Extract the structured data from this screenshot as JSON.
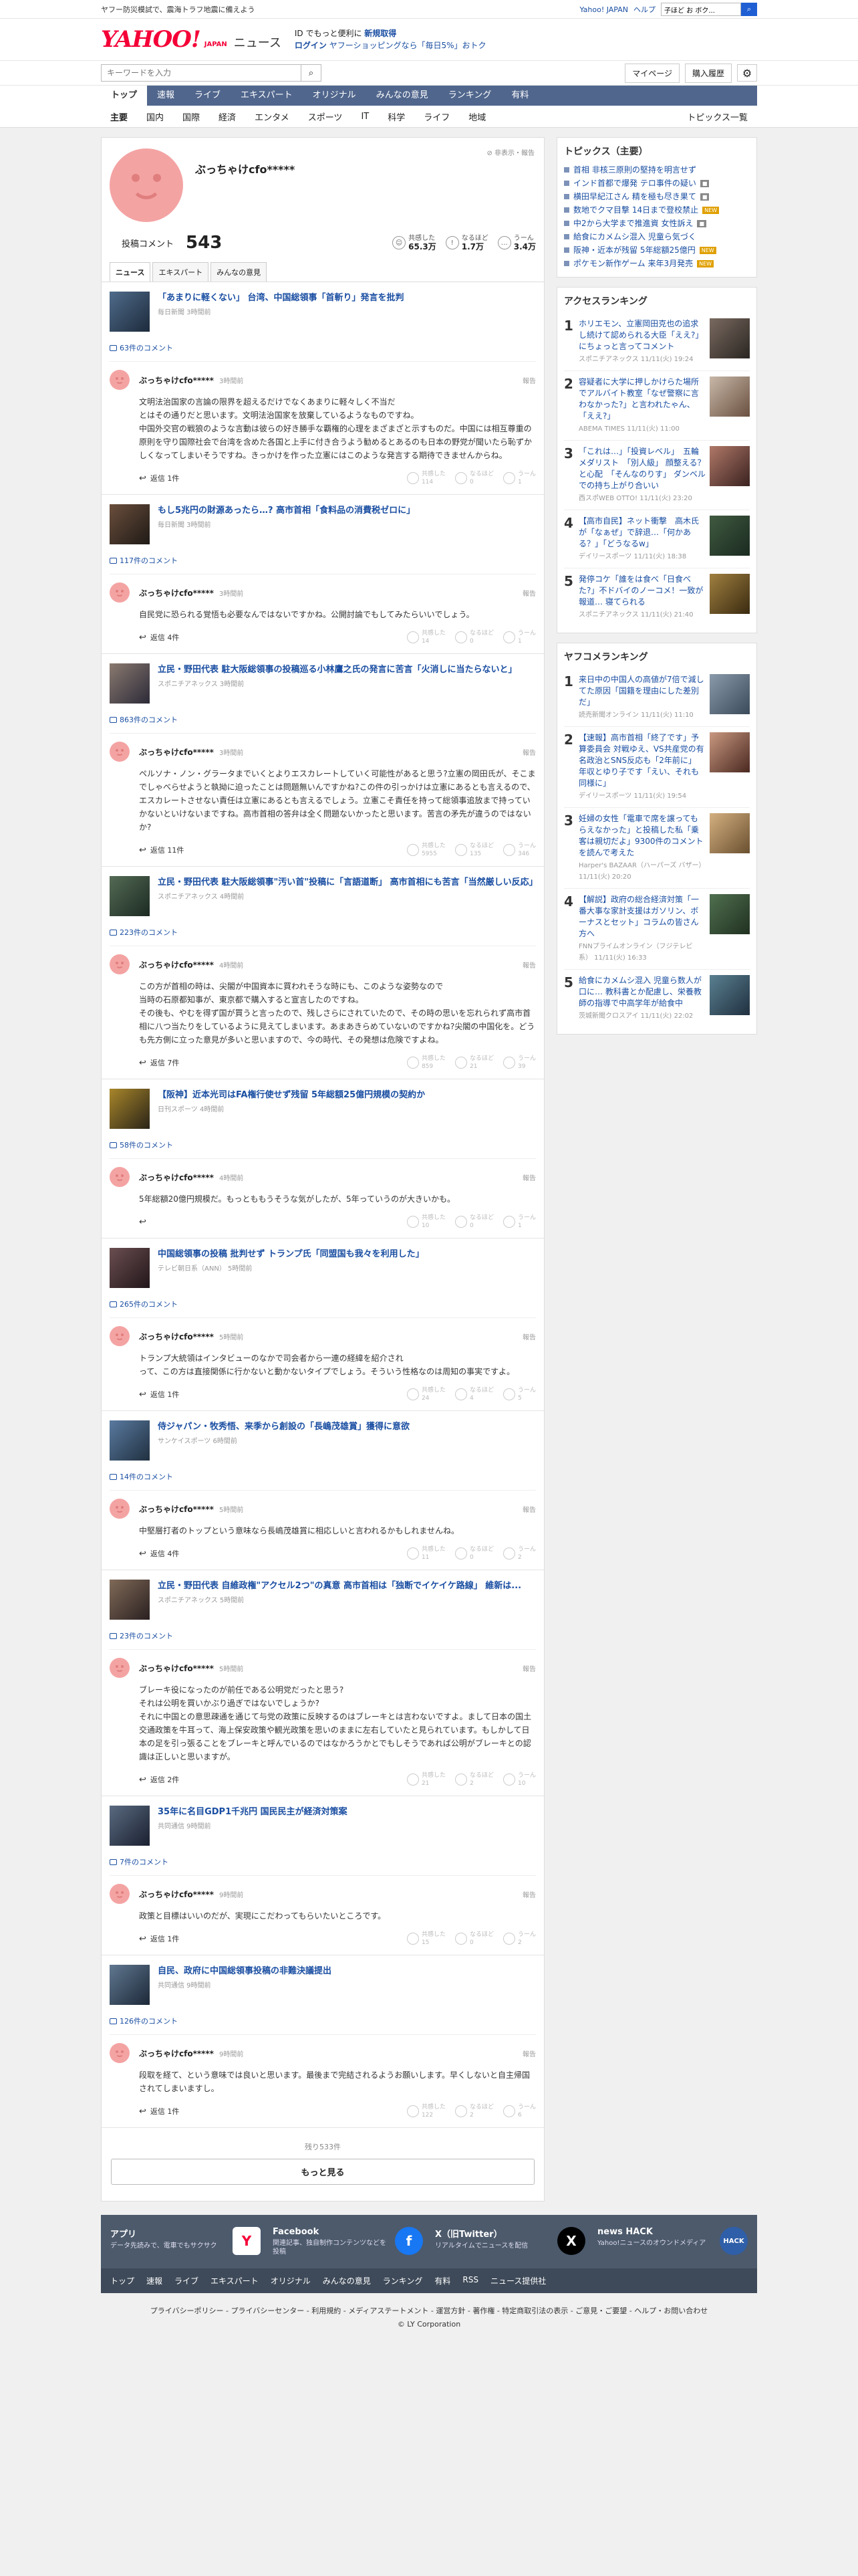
{
  "topbar": {
    "left": "ヤフー防災模試で、震海トラフ地震に備えよう",
    "links": [
      "Yahoo! JAPAN",
      "ヘルプ"
    ],
    "search_placeholder": "ウェブ検索",
    "search_value": "子ほど お ボク..."
  },
  "masthead": {
    "logo": "YAHOO!",
    "logo_sub": "JAPAN",
    "service": "ニュース",
    "promo_line1_prefix": "ID でもっと便利に",
    "promo_line1_link": "新規取得",
    "promo_line2_login": "ログイン",
    "promo_line2_rest": "ヤフーショッピングなら「毎日5%」おトク"
  },
  "search": {
    "placeholder": "キーワードを入力",
    "buttons": [
      "マイページ",
      "購入履歴"
    ]
  },
  "nav_primary": [
    "トップ",
    "速報",
    "ライブ",
    "エキスパート",
    "オリジナル",
    "みんなの意見",
    "ランキング",
    "有料"
  ],
  "nav_secondary": [
    "主要",
    "国内",
    "国際",
    "経済",
    "エンタメ",
    "スポーツ",
    "IT",
    "科学",
    "ライフ",
    "地域"
  ],
  "nav_secondary_right": "トピックス一覧",
  "profile": {
    "name": "ぶっちゃけcfo*****",
    "report": "非表示・報告",
    "count_label": "投稿コメント",
    "count": "543",
    "reactions": [
      {
        "label": "共感した",
        "value": "65.3万"
      },
      {
        "label": "なるほど",
        "value": "1.7万"
      },
      {
        "label": "うーん",
        "value": "3.4万"
      }
    ]
  },
  "tabs": [
    "ニュース",
    "エキスパート",
    "みんなの意見"
  ],
  "vote_labels": [
    "共感した",
    "なるほど",
    "うーん"
  ],
  "reply_label": "返信",
  "report_label": "報告",
  "entries": [
    {
      "title": "「あまりに軽くない」 台湾、中国総領事「首斬り」発言を批判",
      "source": "毎日新聞 3時間前",
      "count": "63件のコメント",
      "user": "ぶっちゃけcfo*****",
      "time": "3時間前",
      "body": "文明法治国家の言論の限界を超えるだけでなくあまりに軽々しく不当だ\nとはその通りだと思います。文明法治国家を放棄しているようなものですね。\n中国外交官の戦狼のような言動は彼らの好き勝手な覇権的心理をまざまざと示すものだ。中国には相互尊重の原則を守り国際社会で台湾を含めた各国と上手に付き合うよう勧めるとあるのも日本の野党が聞いたら恥ずかしくなってしまいそうですね。きっかけを作った立憲にはこのような発言する期待できませんからね。",
      "replies": "返信 1件",
      "v": [
        "114",
        "0",
        "1"
      ]
    },
    {
      "title": "もし5兆円の財源あったら…? 高市首相「食料品の消費税ゼロに」",
      "source": "毎日新聞 3時間前",
      "count": "117件のコメント",
      "user": "ぶっちゃけcfo*****",
      "time": "3時間前",
      "body": "自民党に恐られる覚悟も必要なんではないですかね。公開討論でもしてみたらいいでしょう。",
      "replies": "返信 4件",
      "v": [
        "14",
        "0",
        "1"
      ]
    },
    {
      "title": "立民・野田代表 駐大阪総領事の投稿巡る小林鷹之氏の発言に苦言「火消しに当たらないと」",
      "source": "スポニチアネックス 3時間前",
      "count": "863件のコメント",
      "user": "ぶっちゃけcfo*****",
      "time": "3時間前",
      "body": "ペルソナ・ノン・グラータまでいくとよりエスカレートしていく可能性があると思う?立憲の岡田氏が、そこまでしゃべらせようと執拗に迫ったことは問題無いんですかね?この件の引っかけは立憲にあるとも言えるので、エスカレートさせない責任は立憲にあるとも言えるでしょう。立憲こそ責任を持って総領事追放まで持っていかないといけないまですね。高市首相の答弁は全く問題ないかったと思います。苦言の矛先が違うのではないか?",
      "replies": "返信 11件",
      "v": [
        "5955",
        "135",
        "346"
      ]
    },
    {
      "title": "立民・野田代表 駐大阪総領事\"汚い首\"投稿に「言語道断」 高市首相にも苦言「当然厳しい反応」",
      "source": "スポニチアネックス 4時間前",
      "count": "223件のコメント",
      "user": "ぶっちゃけcfo*****",
      "time": "4時間前",
      "body": "この方が首相の時は、尖閣が中国資本に買われそうな時にも、このような姿勢なので\n当時の石原都知事が、東京都で購入すると宣言したのですね。\nその後も、やむを得ず国が買うと言ったので、残しさらにされていたので、その時の思いを忘れられず高市首相に八つ当たりをしているように見えてしまいます。あまあきらめていないのですかね?尖閣の中国化を。どうも先方側に立った意見が多いと思いますので、今の時代、その発想は危険ですよね。",
      "replies": "返信 7件",
      "v": [
        "859",
        "21",
        "39"
      ]
    },
    {
      "title": "【阪神】近本光司はFA権行使せず残留 5年総額25億円規模の契約か",
      "source": "日刊スポーツ 4時間前",
      "count": "58件のコメント",
      "user": "ぶっちゃけcfo*****",
      "time": "4時間前",
      "body": "5年総額20億円規模だ。もっとももうそうな気がしたが、5年っていうのが大きいかも。",
      "replies": "",
      "v": [
        "10",
        "0",
        "1"
      ]
    },
    {
      "title": "中国総領事の投稿 批判せず トランプ氏「同盟国も我々を利用した」",
      "source": "テレビ朝日系（ANN） 5時間前",
      "count": "265件のコメント",
      "user": "ぶっちゃけcfo*****",
      "time": "5時間前",
      "body": "トランプ大統領はインタビューのなかで司会者から一連の経緯を紹介され\nって、この方は直接関係に行かないと動かないタイプでしょう。そういう性格なのは周知の事実ですよ。",
      "replies": "返信 1件",
      "v": [
        "24",
        "4",
        "5"
      ]
    },
    {
      "title": "侍ジャパン・牧秀悟、来季から創設の「長嶋茂雄賞」獲得に意欲",
      "source": "サンケイスポーツ 6時間前",
      "count": "14件のコメント",
      "user": "ぶっちゃけcfo*****",
      "time": "5時間前",
      "body": "中堅層打者のトップという意味なら長嶋茂雄賞に相応しいと言われるかもしれませんね。",
      "replies": "返信 4件",
      "v": [
        "11",
        "0",
        "2"
      ]
    },
    {
      "title": "立民・野田代表 自維政権\"アクセル2つ\"の真意 高市首相は「独断でイケイケ路線」 維新は...",
      "source": "スポニチアネックス 5時間前",
      "count": "23件のコメント",
      "user": "ぶっちゃけcfo*****",
      "time": "5時間前",
      "body": "ブレーキ役になったのが前任である公明党だったと思う?\nそれは公明を買いかぶり過ぎではないでしょうか?\nそれに中国との意思疎通を通じて与党の政策に反映するのはブレーキとは言わないですよ。まして日本の国土交通政策を牛耳って、海上保安政策や観光政策を思いのままに左右していたと見られています。もしかして日本の足を引っ張ることをブレーキと呼んでいるのではなかろうかとでもしそうであれば公明がブレーキとの認識は正しいと思いますが。",
      "replies": "返信 2件",
      "v": [
        "21",
        "2",
        "10"
      ]
    },
    {
      "title": "35年に名目GDP1千兆円 国民民主が経済対策案",
      "source": "共同通信 9時間前",
      "count": "7件のコメント",
      "user": "ぶっちゃけcfo*****",
      "time": "9時間前",
      "body": "政策と目標はいいのだが、実現にこだわってもらいたいところです。",
      "replies": "返信 1件",
      "v": [
        "15",
        "0",
        "2"
      ]
    },
    {
      "title": "自民、政府に中国総領事投稿の非難決議提出",
      "source": "共同通信 9時間前",
      "count": "126件のコメント",
      "user": "ぶっちゃけcfo*****",
      "time": "9時間前",
      "body": "段取を経て、という意味では良いと思います。最後まで完結されるようお願いします。早くしないと自主帰国されてしまいますし。",
      "replies": "返信 1件",
      "v": [
        "122",
        "2",
        "6"
      ]
    }
  ],
  "more": {
    "remaining": "残り533件",
    "button": "もっと見る"
  },
  "topics": {
    "heading": "トピックス（主要）",
    "items": [
      {
        "text": "首相 非核三原則の堅持を明言せず",
        "badge": ""
      },
      {
        "text": "インド首都で爆発 テロ事件の疑い",
        "badge": "cam"
      },
      {
        "text": "横田早紀江さん 精を極も尽き果て",
        "badge": "cam"
      },
      {
        "text": "数地でクマ目撃 14日まで登校禁止",
        "badge": "new"
      },
      {
        "text": "中2から大学まで推進資 女性訴え",
        "badge": "cam"
      },
      {
        "text": "給食にカメムシ混入 児童ら気づく",
        "badge": ""
      },
      {
        "text": "阪神・近本が残留 5年総額25億円",
        "badge": "new"
      },
      {
        "text": "ポケモン新作ゲーム 来年3月発売",
        "badge": "new"
      }
    ]
  },
  "access_ranking": {
    "heading": "アクセスランキング",
    "items": [
      {
        "n": "1",
        "title": "ホリエモン、立憲岡田克也の追求し続けて認められる大臣「ええ?」にちょっと言ってコメント",
        "src": "スポニチアネックス 11/11(火) 19:24"
      },
      {
        "n": "2",
        "title": "容疑者に大学に押しかけらた場所でアルバイト教室「なぜ警察に言わなかった?」と言われたゃん、「ええ?」",
        "src": "ABEMA TIMES 11/11(火) 11:00"
      },
      {
        "n": "3",
        "title": "「これは…」「投資レベル」　五輪メダリスト　「別人級」 顔整える？と心配　「そんなのりす」 ダンベルでの持ち上がり合いい",
        "src": "西スポWEB OTTO! 11/11(火) 23:20"
      },
      {
        "n": "4",
        "title": "【高市自民】ネット衝撃　高木氏が「なぁぜ」で辞退…「何かある？」「どうなるw」",
        "src": "デイリースポーツ 11/11(火) 18:38"
      },
      {
        "n": "5",
        "title": "発停コケ「誰をは食べ「日食べた?」不ドバイのノーコメ！一致が報道… 寝てられる",
        "src": "スポニチアネックス 11/11(火) 21:40"
      }
    ]
  },
  "yahoo_ranking": {
    "heading": "ヤフコメランキング",
    "items": [
      {
        "n": "1",
        "title": "来日中の中国人の高値が7倍で減してた原因「国籍を理由にした差別だ」",
        "src": "読売新聞オンライン 11/11(火) 11:10"
      },
      {
        "n": "2",
        "title": "【速報】高市首相「終了です」予算委員会 対戦ゆえ、VS共産党の有名政治とSNS反応も「2年前に」 年収とゆり子です「えい、それも同様に」",
        "src": "デイリースポーツ 11/11(火) 19:54"
      },
      {
        "n": "3",
        "title": "妊婦の女性「電車で席を譲ってもらえなかった」と投稿した私「乗客は親切だよ」9300件のコメントを読んで考えた",
        "src": "Harper's BAZAAR（ハーパーズ バザー） 11/11(火) 20:20"
      },
      {
        "n": "4",
        "title": "【解説】政府の総合経済対策「一番大事な家計支援はガソリン、ボーナスとセット」コラムの皆さん方へ",
        "src": "FNNプライムオンライン（フジテレビ系） 11/11(火) 16:33"
      },
      {
        "n": "5",
        "title": "給食にカメムシ混入 児童ら数人が口に… 教科書とか配慮し、栄養教師の指導で中高学年が給食中",
        "src": "茨城新聞クロスアイ 11/11(火) 22:02"
      }
    ]
  },
  "footer": {
    "blocks": [
      {
        "title": "アプリ",
        "desc": "データ先読みで、電車でもサクサク",
        "icon": "Y"
      },
      {
        "title": "Facebook",
        "desc": "関連記事、独自制作コンテンツなどを投稿",
        "icon": "f"
      },
      {
        "title": "X（旧Twitter）",
        "desc": "リアルタイムでニュースを配信",
        "icon": "X"
      },
      {
        "title": "news HACK",
        "desc": "Yahoo!ニュースのオウンドメディア",
        "icon": "HACK"
      }
    ],
    "nav": [
      "トップ",
      "速報",
      "ライブ",
      "エキスパート",
      "オリジナル",
      "みんなの意見",
      "ランキング",
      "有料",
      "RSS",
      "ニュース提供社"
    ],
    "links": "プライバシーポリシー - プライバシーセンター - 利用規約 - メディアステートメント - 運営方針 - 著作権 - 特定商取引法の表示 - ご意見・ご要望 - ヘルプ・お問い合わせ",
    "copyright": "© LY Corporation"
  }
}
